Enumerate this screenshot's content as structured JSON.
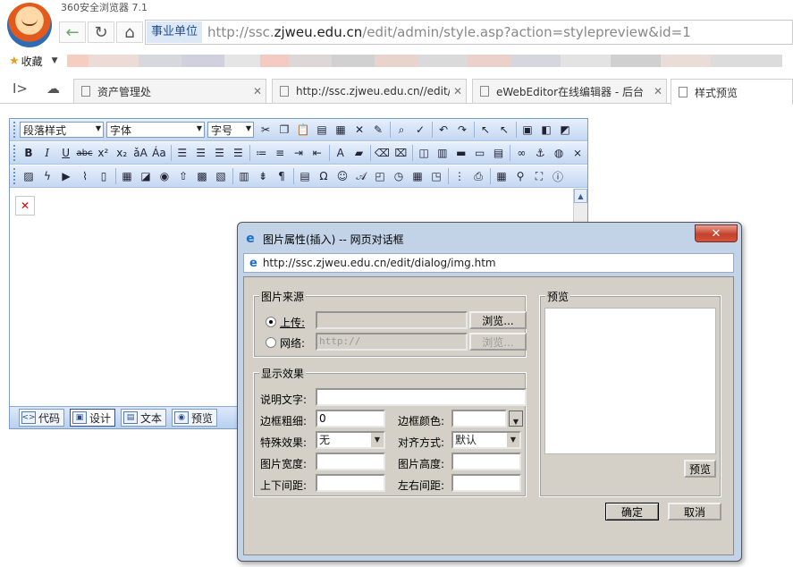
{
  "browser": {
    "app_title": "360安全浏览器 7.1",
    "site_badge": "事业单位",
    "url_prefix": "http://ssc.",
    "url_domain": "zjweu.edu.cn",
    "url_suffix": "/edit/admin/style.asp?action=stylepreview&id=1",
    "favorites_label": "收藏"
  },
  "tabs": [
    {
      "label": "资产管理处",
      "active": false
    },
    {
      "label": "http://ssc.zjweu.edu.cn//edit/",
      "active": false
    },
    {
      "label": "eWebEditor在线编辑器 - 后台",
      "active": false
    },
    {
      "label": "样式预览",
      "active": true
    }
  ],
  "editor": {
    "toolbar": {
      "paragraph_style": "段落样式",
      "font": "字体",
      "font_size": "字号"
    },
    "modes": [
      {
        "label": "代码",
        "icon": "code-icon",
        "active": false
      },
      {
        "label": "设计",
        "icon": "design-icon",
        "active": true
      },
      {
        "label": "文本",
        "icon": "text-icon",
        "active": false
      },
      {
        "label": "预览",
        "icon": "preview-icon",
        "active": false
      }
    ]
  },
  "dialog": {
    "title": "图片属性(插入) -- 网页对话框",
    "close_glyph": "✕",
    "url": "http://ssc.zjweu.edu.cn/edit/dialog/img.htm",
    "source": {
      "legend": "图片来源",
      "upload_label": "上传:",
      "upload_value": "",
      "browse_button": "浏览...",
      "web_label": "网络:",
      "web_placeholder": "http://",
      "browse_button_disabled": "浏览...",
      "selected": "upload"
    },
    "effects": {
      "legend": "显示效果",
      "alt_label": "说明文字:",
      "alt_value": "",
      "border_width_label": "边框粗细:",
      "border_width_value": "0",
      "border_color_label": "边框颜色:",
      "border_color_value": "",
      "special_label": "特殊效果:",
      "special_value": "无",
      "align_label": "对齐方式:",
      "align_value": "默认",
      "width_label": "图片宽度:",
      "width_value": "",
      "height_label": "图片高度:",
      "height_value": "",
      "vspace_label": "上下间距:",
      "vspace_value": "",
      "hspace_label": "左右间距:",
      "hspace_value": ""
    },
    "preview": {
      "legend": "预览",
      "button": "预览"
    },
    "ok_button": "确定",
    "cancel_button": "取消"
  },
  "colors": {
    "toolbar_blue": "#c4d8f2",
    "dialog_face": "#d4d0c8",
    "close_red": "#c5412b"
  }
}
